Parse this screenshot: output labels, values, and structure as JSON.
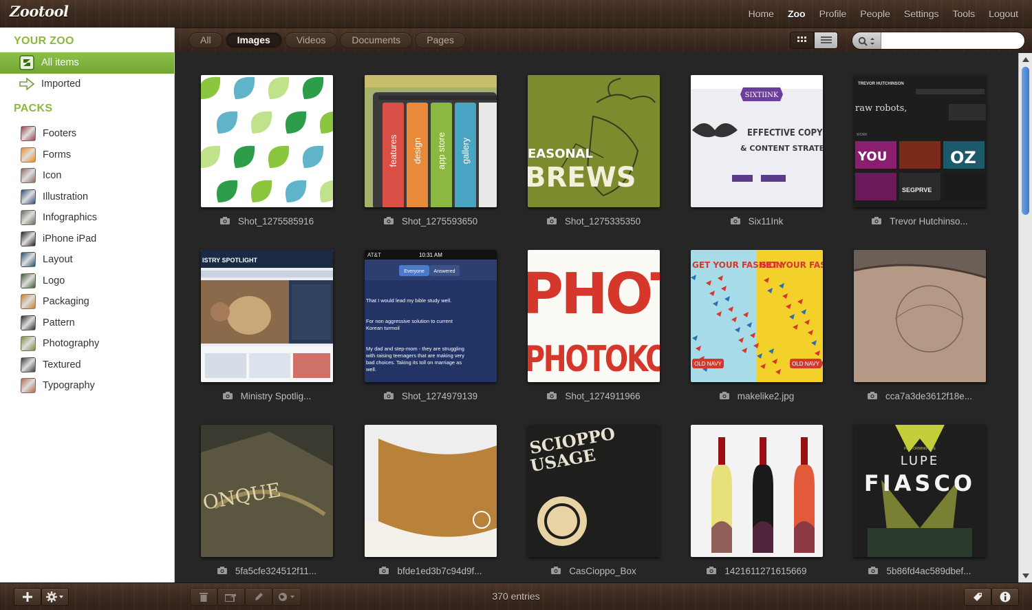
{
  "app": {
    "logo": "Zootool"
  },
  "nav": [
    {
      "label": "Home",
      "active": false
    },
    {
      "label": "Zoo",
      "active": true
    },
    {
      "label": "Profile",
      "active": false
    },
    {
      "label": "People",
      "active": false
    },
    {
      "label": "Settings",
      "active": false
    },
    {
      "label": "Tools",
      "active": false
    },
    {
      "label": "Logout",
      "active": false
    }
  ],
  "filters": [
    {
      "label": "All",
      "active": false
    },
    {
      "label": "Images",
      "active": true
    },
    {
      "label": "Videos",
      "active": false
    },
    {
      "label": "Documents",
      "active": false
    },
    {
      "label": "Pages",
      "active": false
    }
  ],
  "search": {
    "value": "",
    "placeholder": ""
  },
  "sidebar": {
    "zoo_title": "YOUR ZOO",
    "zoo_items": [
      {
        "label": "All items",
        "active": true,
        "icon": "all-items-icon"
      },
      {
        "label": "Imported",
        "active": false,
        "icon": "import-arrow-icon"
      }
    ],
    "packs_title": "PACKS",
    "packs": [
      {
        "label": "Footers",
        "color": "#9c3b4a"
      },
      {
        "label": "Forms",
        "color": "#f08a1c"
      },
      {
        "label": "Icon",
        "color": "#8a6a5c"
      },
      {
        "label": "Illustration",
        "color": "#2e4a7a"
      },
      {
        "label": "Infographics",
        "color": "#6e6a55"
      },
      {
        "label": "iPhone iPad",
        "color": "#1f1f1f"
      },
      {
        "label": "Layout",
        "color": "#244a6e"
      },
      {
        "label": "Logo",
        "color": "#3a5a2a"
      },
      {
        "label": "Packaging",
        "color": "#c97a2a"
      },
      {
        "label": "Pattern",
        "color": "#2a2a2a"
      },
      {
        "label": "Photography",
        "color": "#7a8a3a"
      },
      {
        "label": "Textured",
        "color": "#3a3a3a"
      },
      {
        "label": "Typography",
        "color": "#b5654a"
      }
    ]
  },
  "items": [
    {
      "caption": "Shot_1275585916",
      "thumb": "leaf-pattern"
    },
    {
      "caption": "Shot_1275593650",
      "thumb": "tabs"
    },
    {
      "caption": "Shot_1275335350",
      "thumb": "seasonal-brews"
    },
    {
      "caption": "Six11Ink",
      "thumb": "sixtiink"
    },
    {
      "caption": "Trevor Hutchinso...",
      "thumb": "trevor"
    },
    {
      "caption": "Ministry Spotlig...",
      "thumb": "ministry"
    },
    {
      "caption": "Shot_1274979139",
      "thumb": "iphone"
    },
    {
      "caption": "Shot_1274911966",
      "thumb": "photo-type"
    },
    {
      "caption": "makelike2.jpg",
      "thumb": "old-navy"
    },
    {
      "caption": "cca7a3de3612f18e...",
      "thumb": "book-map"
    },
    {
      "caption": "5fa5cfe324512f11...",
      "thumb": "book-dark"
    },
    {
      "caption": "bfde1ed3b7c94d9f...",
      "thumb": "book-gold"
    },
    {
      "caption": "CasCioppo_Box",
      "thumb": "cioppo"
    },
    {
      "caption": "1421611271615669",
      "thumb": "wine"
    },
    {
      "caption": "5b86fd4ac589dbef...",
      "thumb": "lupe"
    }
  ],
  "thumb_text": {
    "tabs": [
      "features",
      "design",
      "app store",
      "gallery"
    ],
    "seasonal": [
      "EASONAL",
      "BREWS"
    ],
    "sixtiink": [
      "SIXTIINK",
      "EFFECTIVE COPY",
      "& CONTENT STRATEGIES"
    ],
    "trevor": [
      "TREVOR HUTCHINSON",
      "raw robots,",
      "WORK",
      "YOU",
      "OZ",
      "SEGPRVE"
    ],
    "ministry": [
      "ISTRY SPOTLIGHT"
    ],
    "iphone_status": [
      "AT&T",
      "10:31 AM"
    ],
    "iphone_tabs": [
      "Everyone",
      "Answered"
    ],
    "iphone_msgs": [
      "That I would lead my bible study well.",
      "For non aggressive solution to current Korean turmoil",
      "My dad and step-mom - they are struggling with raising teenagers that are making very bad choices. Taking its toll on marriage as well."
    ],
    "photo": [
      "PHOT",
      "PHOTOKOR"
    ],
    "oldnavy": [
      "GET YOUR FASHION",
      "OLD NAVY"
    ],
    "cioppo": [
      "SCIOPPO",
      "USAGE"
    ],
    "lupe": [
      "PERFORMING LIVE",
      "LUPE",
      "FIASCO"
    ]
  },
  "footer": {
    "entries": "370 entries"
  }
}
